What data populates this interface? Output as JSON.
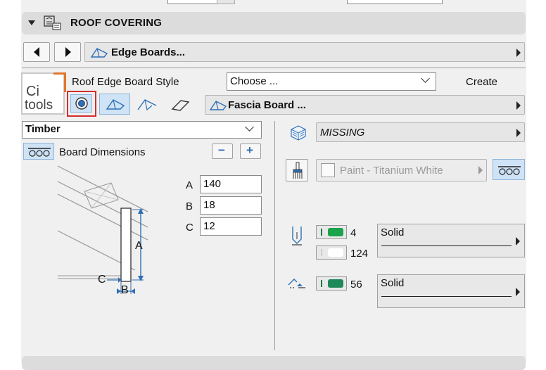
{
  "section": {
    "title": "ROOF COVERING"
  },
  "nav": {
    "current_item": "Edge Boards..."
  },
  "style_row": {
    "label": "Roof Edge Board Style",
    "dropdown_value": "Choose ...",
    "create_label": "Create"
  },
  "logo": {
    "line1": "Ci",
    "line2": "tools"
  },
  "profile": {
    "current_item": "Fascia Board ..."
  },
  "left": {
    "material_value": "Timber",
    "dimensions_label": "Board Dimensions",
    "minus": "−",
    "plus": "+",
    "dims": [
      {
        "label": "A",
        "value": "140"
      },
      {
        "label": "B",
        "value": "18"
      },
      {
        "label": "C",
        "value": "12"
      }
    ],
    "diagram_labels": {
      "a": "A",
      "b": "B",
      "c": "C"
    }
  },
  "right": {
    "building_material": "MISSING",
    "surface": "Paint - Titanium White",
    "pens": [
      {
        "value": "4",
        "color": "#1aa34a"
      },
      {
        "value": "124",
        "color": "#ffffff"
      },
      {
        "value": "56",
        "color": "#1e8a5a"
      }
    ],
    "linetypes": [
      "Solid",
      "Solid"
    ]
  },
  "colors": {
    "accent_red": "#d32f2f",
    "selected_blue": "#cfe3f6",
    "icon_blue": "#2f6fb5"
  }
}
